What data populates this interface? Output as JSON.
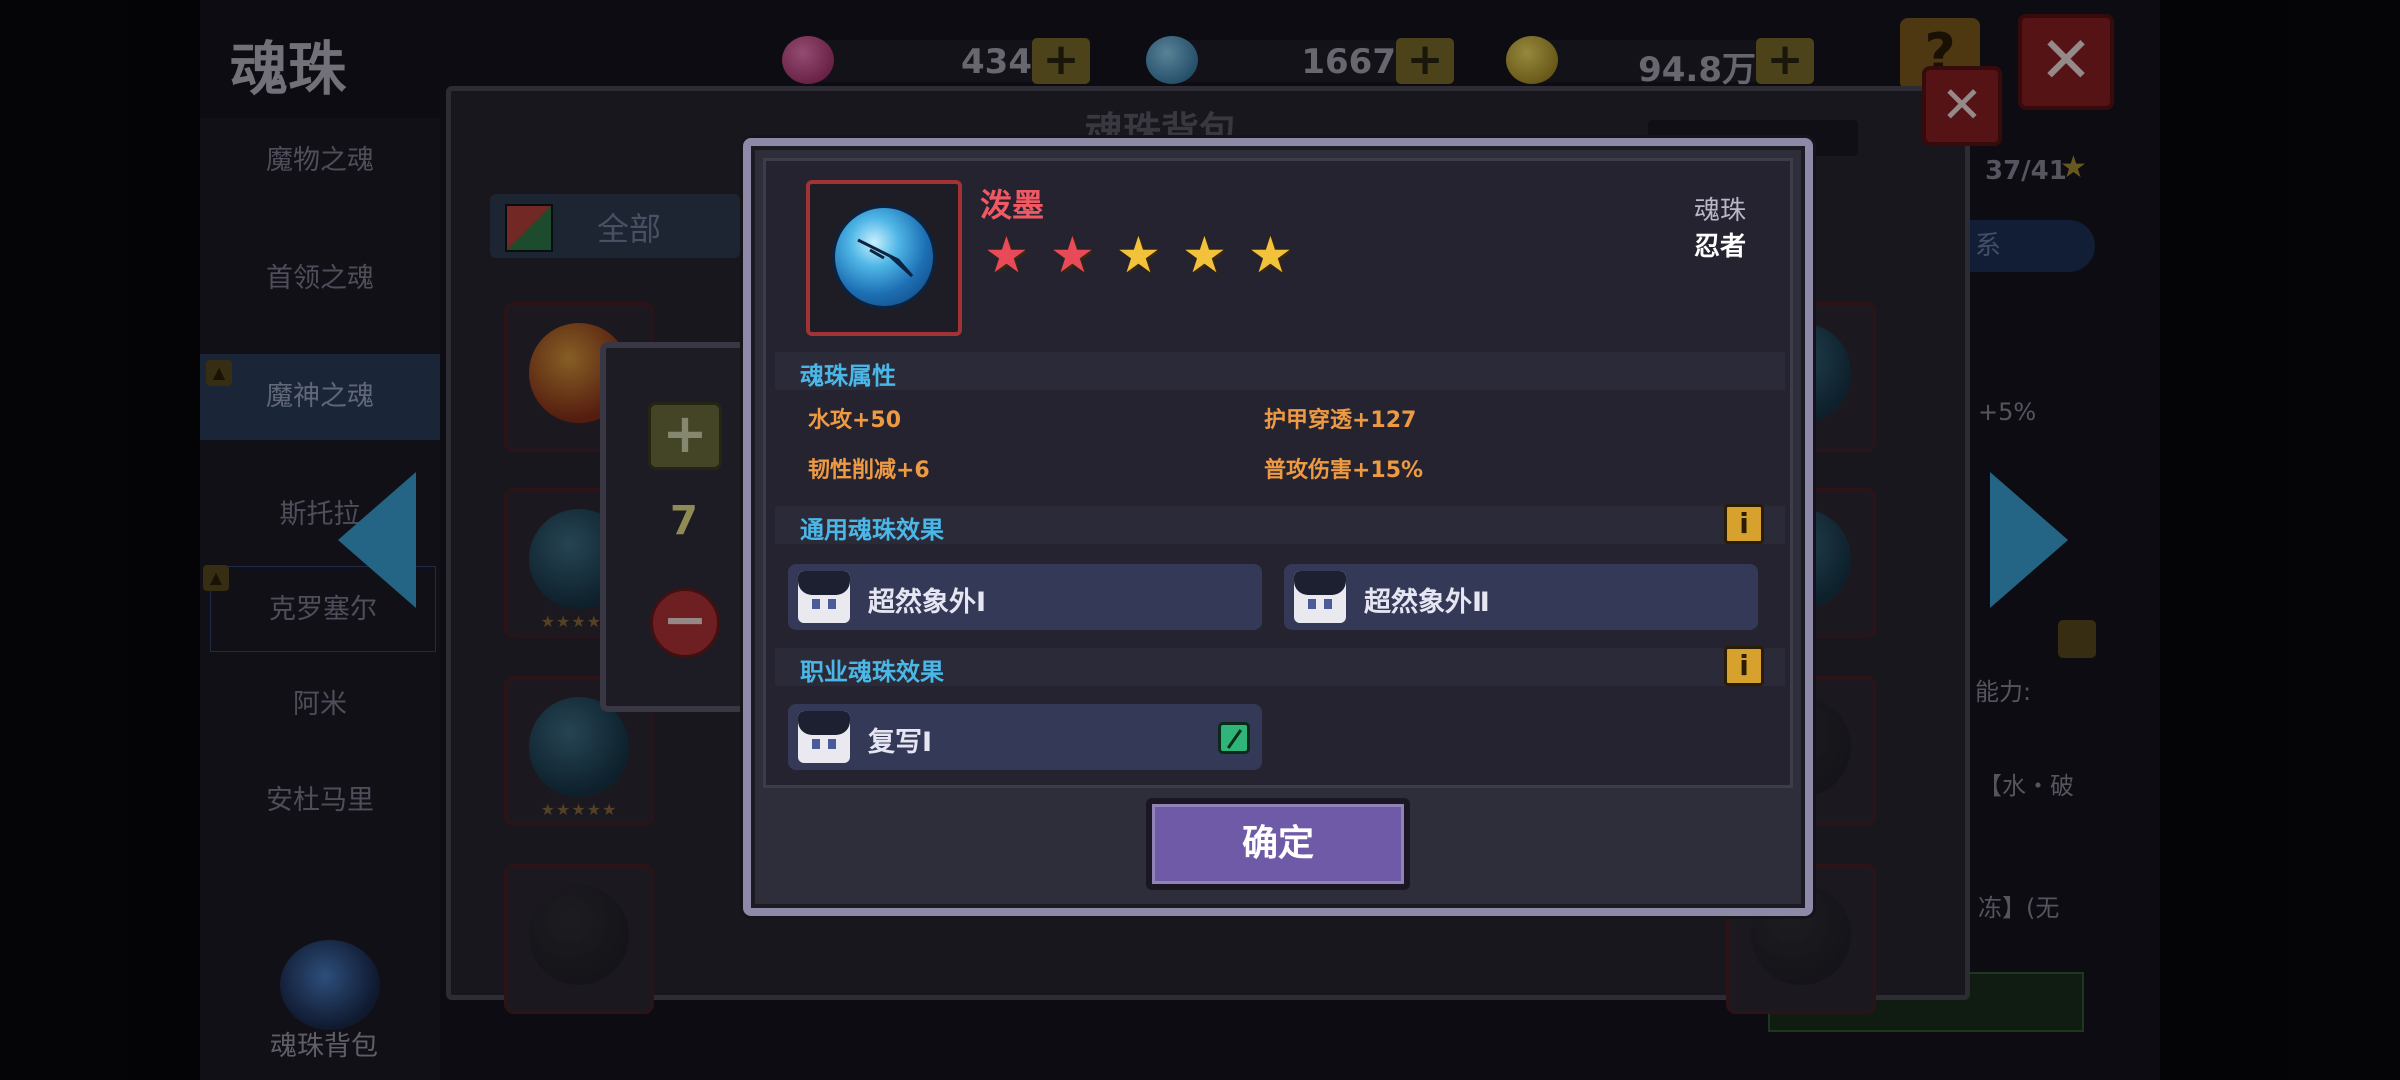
{
  "header": {
    "title": "魂珠",
    "currencies": [
      {
        "icon": "gem-icon",
        "value": "434",
        "color": "#c2307a"
      },
      {
        "icon": "crystal-icon",
        "value": "1667",
        "color": "#3a8fc4"
      },
      {
        "icon": "gold-coin-icon",
        "value": "94.8万",
        "color": "#c9a81f"
      }
    ],
    "help_label": "?",
    "close_label": "✕"
  },
  "sidebar": {
    "items": [
      {
        "label": "魔物之魂"
      },
      {
        "label": "首领之魂"
      },
      {
        "label": "魔神之魂"
      },
      {
        "label": "斯托拉"
      },
      {
        "label": "克罗塞尔"
      },
      {
        "label": "阿米"
      },
      {
        "label": "安杜马里"
      }
    ],
    "bag_label": "魂珠背包"
  },
  "bag_window": {
    "title": "魂珠背包",
    "close_label": "✕",
    "filter_label": "全部"
  },
  "right_panel": {
    "soul_count": "37/41",
    "tab_label": "系",
    "bonus_text": "+5%",
    "ability_label": "能力:",
    "tag_line1": "【水・破",
    "tag_line2": "冻】(无"
  },
  "quantity": {
    "plus": "+",
    "value": "7",
    "minus": "−"
  },
  "dialog": {
    "item_name": "泼墨",
    "stars": {
      "filled_red": 2,
      "filled_gold": 3,
      "total": 5
    },
    "item_type": "魂珠",
    "item_class": "忍者",
    "attributes_title": "魂珠属性",
    "attributes": [
      "水攻+50",
      "护甲穿透+127",
      "韧性削减+6",
      "普攻伤害+15%"
    ],
    "common_effects_title": "通用魂珠效果",
    "common_effects": [
      "超然象外Ⅰ",
      "超然象外Ⅱ"
    ],
    "class_effects_title": "职业魂珠效果",
    "class_effects": [
      "复写Ⅰ"
    ],
    "info_label": "i",
    "confirm_label": "确定"
  },
  "colors": {
    "item_name": "#ee5964",
    "section_title": "#4bb7e6",
    "attribute": "#ee9a43",
    "confirm": "#6f5aa8",
    "star_red": "#e84a5a",
    "star_gold": "#f2c23a"
  }
}
